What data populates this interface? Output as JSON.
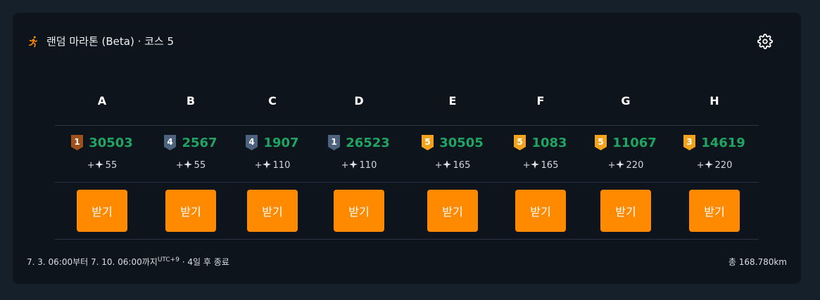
{
  "header": {
    "title": "랜덤 마라톤 (Beta) · 코스 5",
    "icon": "running-person-icon"
  },
  "settings_icon": "gear-icon",
  "colors": {
    "accent": "#ff8a00",
    "value": "#1fa463",
    "tier_bronze": "#a0501a",
    "tier_silver": "#4d637d",
    "tier_gold": "#f2a31b"
  },
  "columns": [
    {
      "letter": "A",
      "tier": "1",
      "tier_color": "bronze",
      "value": "30503",
      "reward_prefix": "+",
      "reward": "55",
      "button": "받기"
    },
    {
      "letter": "B",
      "tier": "4",
      "tier_color": "silver",
      "value": "2567",
      "reward_prefix": "+",
      "reward": "55",
      "button": "받기"
    },
    {
      "letter": "C",
      "tier": "4",
      "tier_color": "silver",
      "value": "1907",
      "reward_prefix": "+",
      "reward": "110",
      "button": "받기"
    },
    {
      "letter": "D",
      "tier": "1",
      "tier_color": "silver",
      "value": "26523",
      "reward_prefix": "+",
      "reward": "110",
      "button": "받기"
    },
    {
      "letter": "E",
      "tier": "5",
      "tier_color": "gold",
      "value": "30505",
      "reward_prefix": "+",
      "reward": "165",
      "button": "받기"
    },
    {
      "letter": "F",
      "tier": "5",
      "tier_color": "gold",
      "value": "1083",
      "reward_prefix": "+",
      "reward": "165",
      "button": "받기"
    },
    {
      "letter": "G",
      "tier": "5",
      "tier_color": "gold",
      "value": "11067",
      "reward_prefix": "+",
      "reward": "220",
      "button": "받기"
    },
    {
      "letter": "H",
      "tier": "3",
      "tier_color": "gold",
      "value": "14619",
      "reward_prefix": "+",
      "reward": "220",
      "button": "받기"
    }
  ],
  "footer": {
    "period": "7. 3. 06:00부터 7. 10. 06:00까지",
    "timezone": "UTC+9",
    "remaining": " · 4일 후 종료",
    "total": "총 168.780km"
  }
}
